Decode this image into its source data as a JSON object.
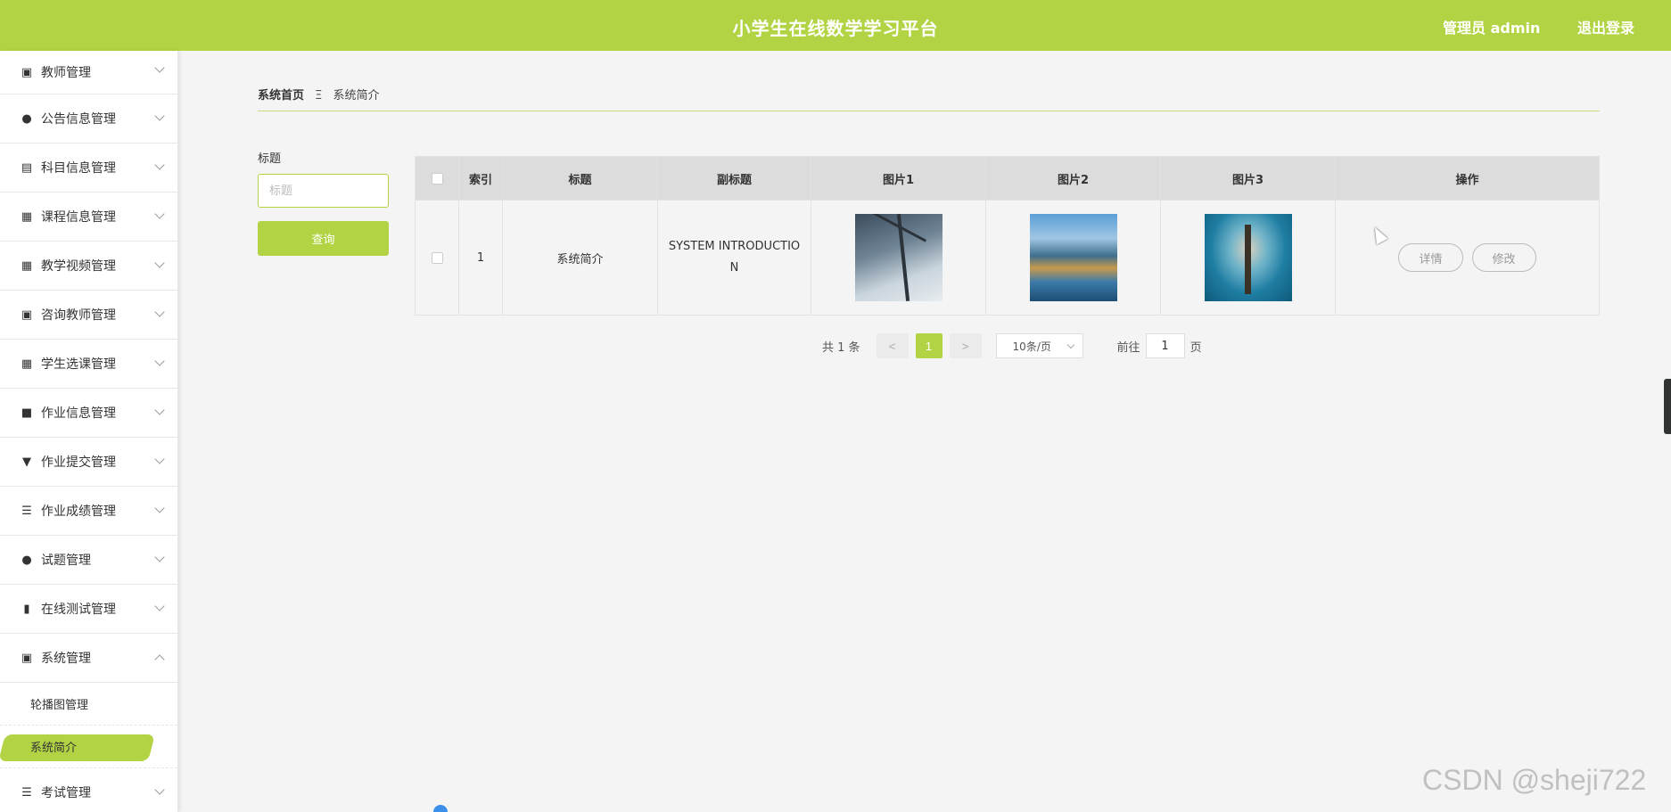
{
  "header": {
    "title": "小学生在线数学学习平台",
    "admin": "管理员 admin",
    "logout": "退出登录"
  },
  "sidebar": {
    "items": [
      {
        "label": "教师管理",
        "icon": "clipboard-check-icon",
        "glyph": "▣"
      },
      {
        "label": "公告信息管理",
        "icon": "location-pin-icon",
        "glyph": "●"
      },
      {
        "label": "科目信息管理",
        "icon": "briefcase-icon",
        "glyph": "▤"
      },
      {
        "label": "课程信息管理",
        "icon": "grid-icon",
        "glyph": "▦"
      },
      {
        "label": "教学视频管理",
        "icon": "grid-icon",
        "glyph": "▦"
      },
      {
        "label": "咨询教师管理",
        "icon": "clipboard-icon",
        "glyph": "▣"
      },
      {
        "label": "学生选课管理",
        "icon": "grid-icon",
        "glyph": "▦"
      },
      {
        "label": "作业信息管理",
        "icon": "ticket-icon",
        "glyph": "■"
      },
      {
        "label": "作业提交管理",
        "icon": "stamp-icon",
        "glyph": "▼"
      },
      {
        "label": "作业成绩管理",
        "icon": "sliders-icon",
        "glyph": "☰"
      },
      {
        "label": "试题管理",
        "icon": "user-icon",
        "glyph": "●"
      },
      {
        "label": "在线测试管理",
        "icon": "bar-chart-icon",
        "glyph": "▮"
      },
      {
        "label": "系统管理",
        "icon": "clipboard-x-icon",
        "glyph": "▣"
      }
    ],
    "sub_items": [
      "轮播图管理",
      "系统简介"
    ],
    "last_item": {
      "label": "考试管理",
      "icon": "list-icon",
      "glyph": "☰"
    }
  },
  "breadcrumb": {
    "home": "系统首页",
    "separator": "Ξ",
    "current": "系统简介"
  },
  "search": {
    "label": "标题",
    "placeholder": "标题",
    "button": "查询"
  },
  "table": {
    "headers": [
      "索引",
      "标题",
      "副标题",
      "图片1",
      "图片2",
      "图片3",
      "操作"
    ],
    "rows": [
      {
        "index": "1",
        "title": "系统简介",
        "subtitle": "SYSTEM INTRODUCTION",
        "detail": "详情",
        "edit": "修改"
      }
    ]
  },
  "pagination": {
    "total": "共 1 条",
    "prev": "<",
    "current": "1",
    "next": ">",
    "page_size": "10条/页",
    "goto_label": "前往",
    "goto_value": "1",
    "page_suffix": "页"
  },
  "watermark": "CSDN @sheji722",
  "colors": {
    "accent": "#b2d444",
    "background": "#f4f4f4",
    "table_header": "#dcdcdc"
  }
}
